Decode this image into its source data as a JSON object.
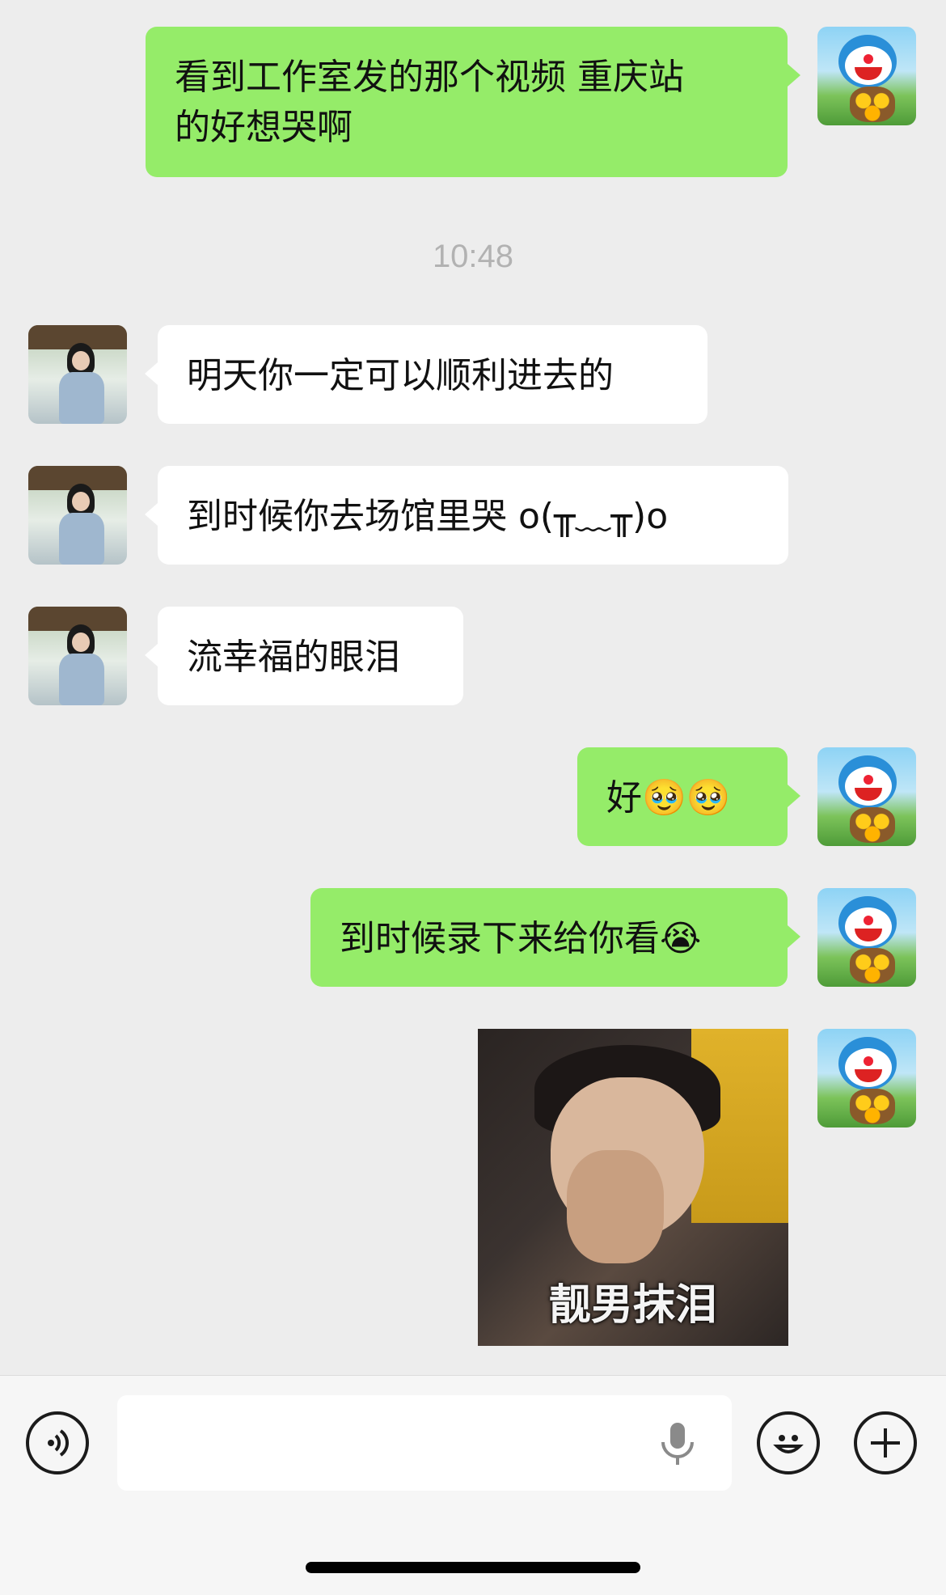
{
  "messages": [
    {
      "sender": "me",
      "text": "看到工作室发的那个视频 重庆站\n的好想哭啊"
    },
    {
      "sender": "other",
      "text": "明天你一定可以顺利进去的"
    },
    {
      "sender": "other",
      "text": "到时候你去场馆里哭 o(╥﹏╥)o"
    },
    {
      "sender": "other",
      "text": "流幸福的眼泪"
    },
    {
      "sender": "me",
      "text": "好🥹🥹"
    },
    {
      "sender": "me",
      "text": "到时候录下来给你看😭"
    },
    {
      "sender": "me",
      "type": "sticker",
      "caption": "靓男抹泪"
    }
  ],
  "timestamp": "10:48",
  "input_bar": {
    "voice_icon": "voice-icon",
    "text_value": "",
    "mic_icon": "mic-icon",
    "emoji_icon": "emoji-icon",
    "plus_icon": "plus-icon"
  },
  "colors": {
    "my_bubble": "#95ec69",
    "other_bubble": "#ffffff",
    "background": "#ededed"
  }
}
